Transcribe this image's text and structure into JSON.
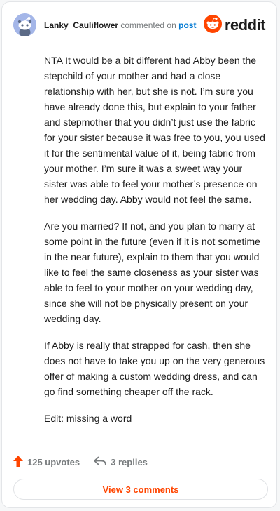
{
  "header": {
    "username": "Lanky_Cauliflower",
    "action_text": "commented on",
    "post_link": "post",
    "logo_text": "reddit"
  },
  "comment": {
    "paragraphs": [
      "NTA It would be a bit different had Abby been the stepchild of your mother and had a close relationship with her, but she is not. I’m sure you have already done this, but explain to your father and stepmother that you didn’t just use the fabric for your sister because it was free to you, you used it for the sentimental value of it, being fabric from your mother. I’m sure it was a sweet way your sister was able to feel your mother’s presence on her wedding day. Abby would not feel the same.",
      "Are you married? If not, and you plan to marry at some point in the future (even if it is not sometime in the near future), explain to them that you would like to feel the same closeness as your sister was able to feel to your mother on your wedding day, since she will not be physically present on your wedding day.",
      "If Abby is really that strapped for cash, then she does not have to take you up on the very generous offer of making a custom wedding dress, and can go find something cheaper off the rack.",
      "Edit: missing a word"
    ]
  },
  "actions": {
    "upvotes": "125 upvotes",
    "replies": "3 replies"
  },
  "footer": {
    "view_comments": "View 3 comments"
  },
  "icons": {
    "avatar": "snoo-avatar-icon",
    "logo": "reddit-logo-icon",
    "upvote": "upvote-arrow-icon",
    "reply": "reply-arrow-icon"
  },
  "colors": {
    "brand": "#ff4500",
    "link": "#0079d3",
    "muted": "#787c7e",
    "text": "#1c1c1c"
  }
}
